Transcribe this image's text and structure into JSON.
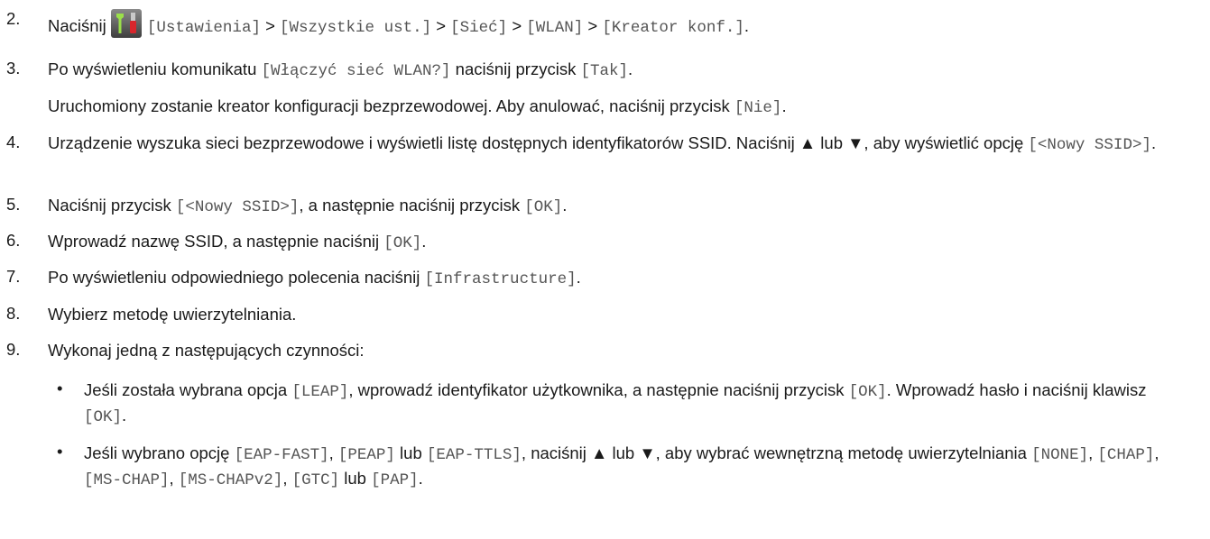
{
  "steps": [
    {
      "n": "2.",
      "segs": [
        {
          "t": "Naciśnij "
        },
        {
          "icon": "settings-tools-icon"
        },
        {
          "c": "[Ustawienia]"
        },
        {
          "t": " > "
        },
        {
          "c": "[Wszystkie ust.]"
        },
        {
          "t": " > "
        },
        {
          "c": "[Sieć]"
        },
        {
          "t": " > "
        },
        {
          "c": "[WLAN]"
        },
        {
          "t": " > "
        },
        {
          "c": "[Kreator konf.]"
        },
        {
          "t": "."
        }
      ]
    },
    {
      "n": "3.",
      "segs": [
        {
          "t": "Po wyświetleniu komunikatu "
        },
        {
          "c": "[Włączyć sieć WLAN?]"
        },
        {
          "t": " naciśnij przycisk "
        },
        {
          "c": "[Tak]"
        },
        {
          "t": "."
        }
      ]
    },
    {
      "n": "",
      "segs": [
        {
          "t": "Uruchomiony zostanie kreator konfiguracji bezprzewodowej. Aby anulować, naciśnij przycisk "
        },
        {
          "c": "[Nie]"
        },
        {
          "t": "."
        }
      ]
    },
    {
      "n": "4.",
      "segs": [
        {
          "t": "Urządzenie wyszuka sieci bezprzewodowe i wyświetli listę dostępnych identyfikatorów SSID. Naciśnij ▲ lub ▼, aby wyświetlić opcję "
        },
        {
          "c": "[<Nowy SSID>]"
        },
        {
          "t": "."
        }
      ]
    },
    {
      "n": "5.",
      "segs": [
        {
          "t": "Naciśnij przycisk "
        },
        {
          "c": "[<Nowy SSID>]"
        },
        {
          "t": ", a następnie naciśnij przycisk "
        },
        {
          "c": "[OK]"
        },
        {
          "t": "."
        }
      ]
    },
    {
      "n": "6.",
      "segs": [
        {
          "t": "Wprowadź nazwę SSID, a następnie naciśnij "
        },
        {
          "c": "[OK]"
        },
        {
          "t": "."
        }
      ]
    },
    {
      "n": "7.",
      "segs": [
        {
          "t": "Po wyświetleniu odpowiedniego polecenia naciśnij "
        },
        {
          "c": "[Infrastructure]"
        },
        {
          "t": "."
        }
      ]
    },
    {
      "n": "8.",
      "segs": [
        {
          "t": "Wybierz metodę uwierzytelniania."
        }
      ]
    },
    {
      "n": "9.",
      "segs": [
        {
          "t": "Wykonaj jedną z następujących czynności:"
        }
      ]
    }
  ],
  "bullets": [
    {
      "segs": [
        {
          "t": "Jeśli została wybrana opcja "
        },
        {
          "c": "[LEAP]"
        },
        {
          "t": ", wprowadź identyfikator użytkownika, a następnie naciśnij przycisk "
        },
        {
          "c": "[OK]"
        },
        {
          "t": ". Wprowadź hasło i naciśnij klawisz "
        },
        {
          "c": "[OK]"
        },
        {
          "t": "."
        }
      ]
    },
    {
      "segs": [
        {
          "t": "Jeśli wybrano opcję "
        },
        {
          "c": "[EAP-FAST]"
        },
        {
          "t": ", "
        },
        {
          "c": "[PEAP]"
        },
        {
          "t": " lub "
        },
        {
          "c": "[EAP-TTLS]"
        },
        {
          "t": ", naciśnij ▲ lub ▼, aby wybrać wewnętrzną metodę uwierzytelniania "
        },
        {
          "c": "[NONE]"
        },
        {
          "t": ", "
        },
        {
          "c": "[CHAP]"
        },
        {
          "t": ", "
        },
        {
          "c": "[MS-CHAP]"
        },
        {
          "t": ", "
        },
        {
          "c": "[MS-CHAPv2]"
        },
        {
          "t": ", "
        },
        {
          "c": "[GTC]"
        },
        {
          "t": " lub "
        },
        {
          "c": "[PAP]"
        },
        {
          "t": "."
        }
      ]
    }
  ],
  "bullet_glyph": "•"
}
